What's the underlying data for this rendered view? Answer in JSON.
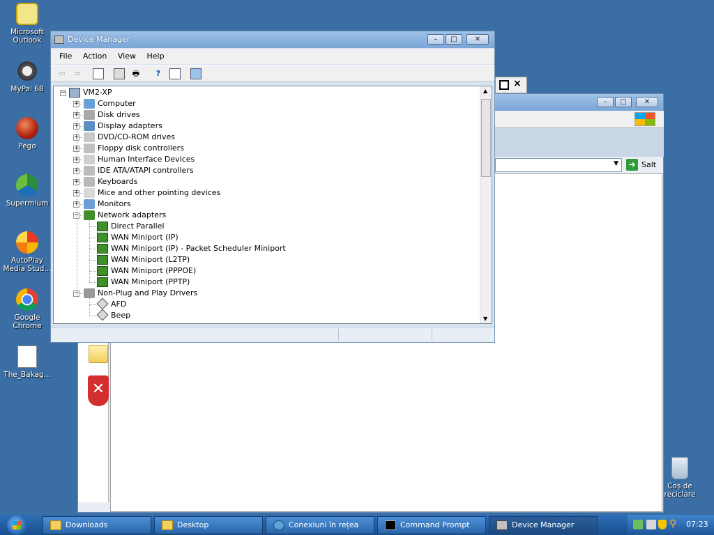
{
  "desktop": {
    "icons": [
      {
        "label": "Microsoft Outlook",
        "icon": "outlook-icon"
      },
      {
        "label": "MyPal 68",
        "icon": "raccoon-icon"
      },
      {
        "label": "Pego",
        "icon": "pego-icon"
      },
      {
        "label": "Supermium",
        "icon": "supermium-icon"
      },
      {
        "label": "AutoPlay Media Stud...",
        "icon": "autoplay-icon"
      },
      {
        "label": "Google Chrome",
        "icon": "chrome-icon"
      },
      {
        "label": "The_Bakag...",
        "icon": "document-icon"
      },
      {
        "label": "Coș de reciclare",
        "icon": "recycle-bin-icon"
      }
    ]
  },
  "background_window": {
    "go_label": "Salt"
  },
  "device_manager": {
    "title": "Device Manager",
    "menu": [
      "File",
      "Action",
      "View",
      "Help"
    ],
    "root": "VM2-XP",
    "categories": [
      {
        "label": "Computer"
      },
      {
        "label": "Disk drives"
      },
      {
        "label": "Display adapters"
      },
      {
        "label": "DVD/CD-ROM drives"
      },
      {
        "label": "Floppy disk controllers"
      },
      {
        "label": "Human Interface Devices"
      },
      {
        "label": "IDE ATA/ATAPI controllers"
      },
      {
        "label": "Keyboards"
      },
      {
        "label": "Mice and other pointing devices"
      },
      {
        "label": "Monitors"
      },
      {
        "label": "Network adapters",
        "expanded": true,
        "children": [
          "Direct Parallel",
          "WAN Miniport (IP)",
          "WAN Miniport (IP) - Packet Scheduler Miniport",
          "WAN Miniport (L2TP)",
          "WAN Miniport (PPPOE)",
          "WAN Miniport (PPTP)"
        ]
      },
      {
        "label": "Non-Plug and Play Drivers",
        "expanded": true,
        "children": [
          "AFD",
          "Beep"
        ]
      }
    ]
  },
  "taskbar": {
    "buttons": [
      {
        "label": "Downloads",
        "icon": "folder-icon"
      },
      {
        "label": "Desktop",
        "icon": "folder-icon"
      },
      {
        "label": "Conexiuni în rețea",
        "icon": "network-icon"
      },
      {
        "label": "Command Prompt",
        "icon": "cmd-icon"
      },
      {
        "label": "Device Manager",
        "icon": "device-manager-icon"
      }
    ],
    "clock": "07:23"
  },
  "colors": {
    "desktop": "#3a6ea5",
    "taskbar": "#245fa6",
    "title_bar": "#8fb6e3"
  }
}
